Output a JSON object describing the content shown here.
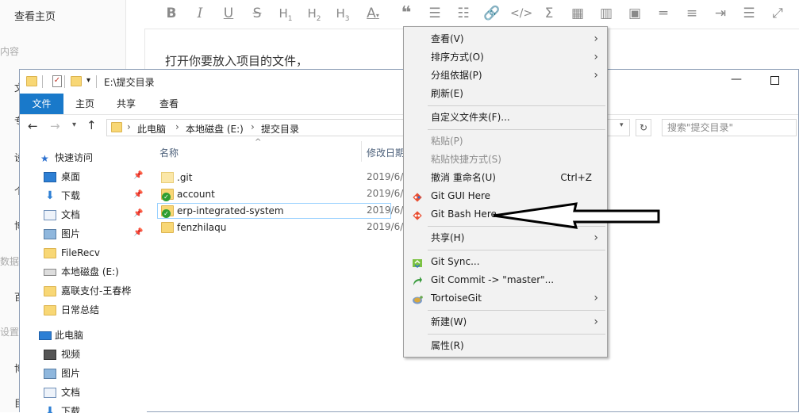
{
  "editor": {
    "sidebar_home": "查看主页",
    "sidebar_fragments": [
      "内容",
      "文",
      "专",
      "设",
      "个",
      "博",
      "数据",
      "百",
      "设置",
      "博",
      "目"
    ],
    "body_text": "打开你要放入项目的文件，"
  },
  "explorer": {
    "title": "E:\\提交目录",
    "quick_access_caret": "▾",
    "ribbon_tabs": [
      "文件",
      "主页",
      "共享",
      "查看"
    ],
    "breadcrumb": [
      "此电脑",
      "本地磁盘 (E:)",
      "提交目录"
    ],
    "search_placeholder": "搜索\"提交目录\"",
    "columns": {
      "name": "名称",
      "modified": "修改日期"
    },
    "sort_indicator": "^",
    "files": [
      {
        "name": ".git",
        "date": "2019/6/",
        "icon": "folder-pale"
      },
      {
        "name": "account",
        "date": "2019/6/",
        "icon": "folder-check"
      },
      {
        "name": "erp-integrated-system",
        "date": "2019/6/",
        "icon": "folder-check",
        "selected": true
      },
      {
        "name": "fenzhilaqu",
        "date": "2019/6/",
        "icon": "folder"
      }
    ],
    "nav": {
      "quick_access": "快速访问",
      "items": [
        {
          "label": "桌面",
          "pinned": true,
          "icon": "desktop-icon"
        },
        {
          "label": "下载",
          "pinned": true,
          "icon": "download-icon"
        },
        {
          "label": "文档",
          "pinned": true,
          "icon": "documents-icon"
        },
        {
          "label": "图片",
          "pinned": true,
          "icon": "pictures-icon"
        },
        {
          "label": "FileRecv",
          "pinned": false,
          "icon": "folder-icon"
        },
        {
          "label": "本地磁盘 (E:)",
          "pinned": false,
          "icon": "drive-icon"
        },
        {
          "label": "嘉联支付-王春桦",
          "pinned": false,
          "icon": "folder-icon"
        },
        {
          "label": "日常总结",
          "pinned": false,
          "icon": "folder-icon"
        }
      ],
      "this_pc": "此电脑",
      "pc_items": [
        {
          "label": "视频",
          "icon": "videos-icon"
        },
        {
          "label": "图片",
          "icon": "pictures-icon"
        },
        {
          "label": "文档",
          "icon": "documents-icon"
        },
        {
          "label": "下载",
          "icon": "download-icon"
        }
      ]
    }
  },
  "context_menu": {
    "items": [
      {
        "label": "查看(V)",
        "submenu": true
      },
      {
        "label": "排序方式(O)",
        "submenu": true
      },
      {
        "label": "分组依据(P)",
        "submenu": true
      },
      {
        "label": "刷新(E)"
      },
      {
        "label": "自定义文件夹(F)..."
      },
      {
        "label": "粘贴(P)",
        "disabled": true
      },
      {
        "label": "粘贴快捷方式(S)",
        "disabled": true
      },
      {
        "label": "撤消 重命名(U)",
        "accelerator": "Ctrl+Z"
      },
      {
        "label": "Git GUI Here",
        "icon": "git-gui-icon"
      },
      {
        "label": "Git Bash Here",
        "icon": "git-bash-icon"
      },
      {
        "label": "共享(H)",
        "submenu": true
      },
      {
        "label": "Git Sync...",
        "icon": "git-sync-icon"
      },
      {
        "label": "Git Commit -> \"master\"...",
        "icon": "git-commit-icon"
      },
      {
        "label": "TortoiseGit",
        "submenu": true,
        "icon": "tortoisegit-icon"
      },
      {
        "label": "新建(W)",
        "submenu": true
      },
      {
        "label": "属性(R)"
      }
    ]
  },
  "colors": {
    "ribbon_file_tab": "#1979ca",
    "selection": "#cce8ff",
    "menu_bg": "#f2f2f2"
  }
}
